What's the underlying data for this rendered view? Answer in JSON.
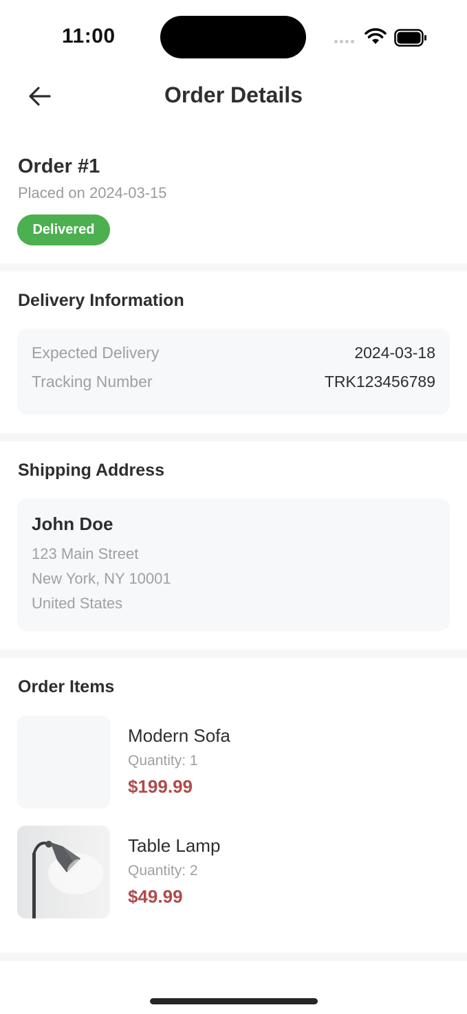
{
  "status_bar": {
    "time": "11:00"
  },
  "header": {
    "title": "Order Details",
    "back_icon": "arrow-left-icon"
  },
  "order": {
    "title": "Order #1",
    "placed": "Placed on 2024-03-15",
    "status": "Delivered",
    "status_color": "#4caf50"
  },
  "delivery": {
    "section_title": "Delivery Information",
    "rows": [
      {
        "label": "Expected Delivery",
        "value": "2024-03-18"
      },
      {
        "label": "Tracking Number",
        "value": "TRK123456789"
      }
    ]
  },
  "shipping": {
    "section_title": "Shipping Address",
    "name": "John Doe",
    "lines": [
      "123 Main Street",
      "New York, NY 10001",
      "United States"
    ]
  },
  "items": {
    "section_title": "Order Items",
    "list": [
      {
        "name": "Modern Sofa",
        "quantity": "Quantity: 1",
        "price": "$199.99",
        "image": "placeholder"
      },
      {
        "name": "Table Lamp",
        "quantity": "Quantity: 2",
        "price": "$49.99",
        "image": "lamp-photo"
      }
    ]
  },
  "colors": {
    "price": "#b04a4a",
    "card_bg": "#f7f8fa",
    "divider": "#f5f6f7"
  }
}
